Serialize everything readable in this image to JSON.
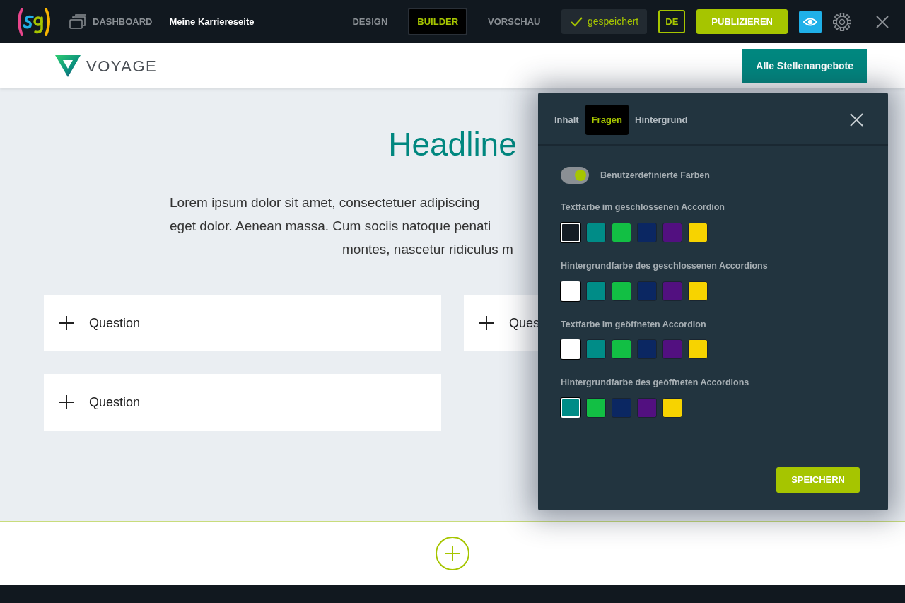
{
  "topbar": {
    "dashboard": "DASHBOARD",
    "page_title": "Meine Karriereseite",
    "modes": [
      {
        "label": "DESIGN",
        "selected": false
      },
      {
        "label": "BUILDER",
        "selected": true
      },
      {
        "label": "VORSCHAU",
        "selected": false
      }
    ],
    "saved": "gespeichert",
    "language": "DE",
    "publish": "PUBLIZIEREN"
  },
  "site_header": {
    "brand": "VOYAGE",
    "cta": "Alle Stellenangebote"
  },
  "content": {
    "headline": "Headline",
    "paragraph_lines": [
      "Lorem ipsum dolor sit amet, consectetuer adipiscing",
      "eget dolor. Aenean massa. Cum sociis natoque penati",
      "montes, nascetur ridiculus m"
    ],
    "questions": [
      {
        "label": "Question"
      },
      {
        "label": "Ques"
      },
      {
        "label": "Question"
      }
    ]
  },
  "panel": {
    "tabs": [
      {
        "label": "Inhalt",
        "selected": false
      },
      {
        "label": "Fragen",
        "selected": true
      },
      {
        "label": "Hintergrund",
        "selected": false
      }
    ],
    "toggle": {
      "label": "Benutzerdefinierte Farben",
      "on": true
    },
    "groups": [
      {
        "label": "Textfarbe im geschlossenen Accordion",
        "swatches": [
          {
            "color": "#141c24",
            "selected": true
          },
          {
            "color": "#008c87",
            "selected": false
          },
          {
            "color": "#12bf44",
            "selected": false
          },
          {
            "color": "#0b2762",
            "selected": false
          },
          {
            "color": "#521080",
            "selected": false
          },
          {
            "color": "#f7d300",
            "selected": false
          }
        ]
      },
      {
        "label": "Hintergrundfarbe des geschlossenen Accordions",
        "swatches": [
          {
            "color": "#ffffff",
            "selected": true
          },
          {
            "color": "#008c87",
            "selected": false
          },
          {
            "color": "#12bf44",
            "selected": false
          },
          {
            "color": "#0b2762",
            "selected": false
          },
          {
            "color": "#521080",
            "selected": false
          },
          {
            "color": "#f7d300",
            "selected": false
          }
        ]
      },
      {
        "label": "Textfarbe im geöffneten Accordion",
        "swatches": [
          {
            "color": "#ffffff",
            "selected": true
          },
          {
            "color": "#008c87",
            "selected": false
          },
          {
            "color": "#12bf44",
            "selected": false
          },
          {
            "color": "#0b2762",
            "selected": false
          },
          {
            "color": "#521080",
            "selected": false
          },
          {
            "color": "#f7d300",
            "selected": false
          }
        ]
      },
      {
        "label": "Hintergrundfarbe des geöffneten Accordions",
        "swatches": [
          {
            "color": "#008c87",
            "selected": true
          },
          {
            "color": "#12bf44",
            "selected": false
          },
          {
            "color": "#0b2762",
            "selected": false
          },
          {
            "color": "#521080",
            "selected": false
          },
          {
            "color": "#f7d300",
            "selected": false
          }
        ]
      }
    ],
    "save": "SPEICHERN"
  }
}
